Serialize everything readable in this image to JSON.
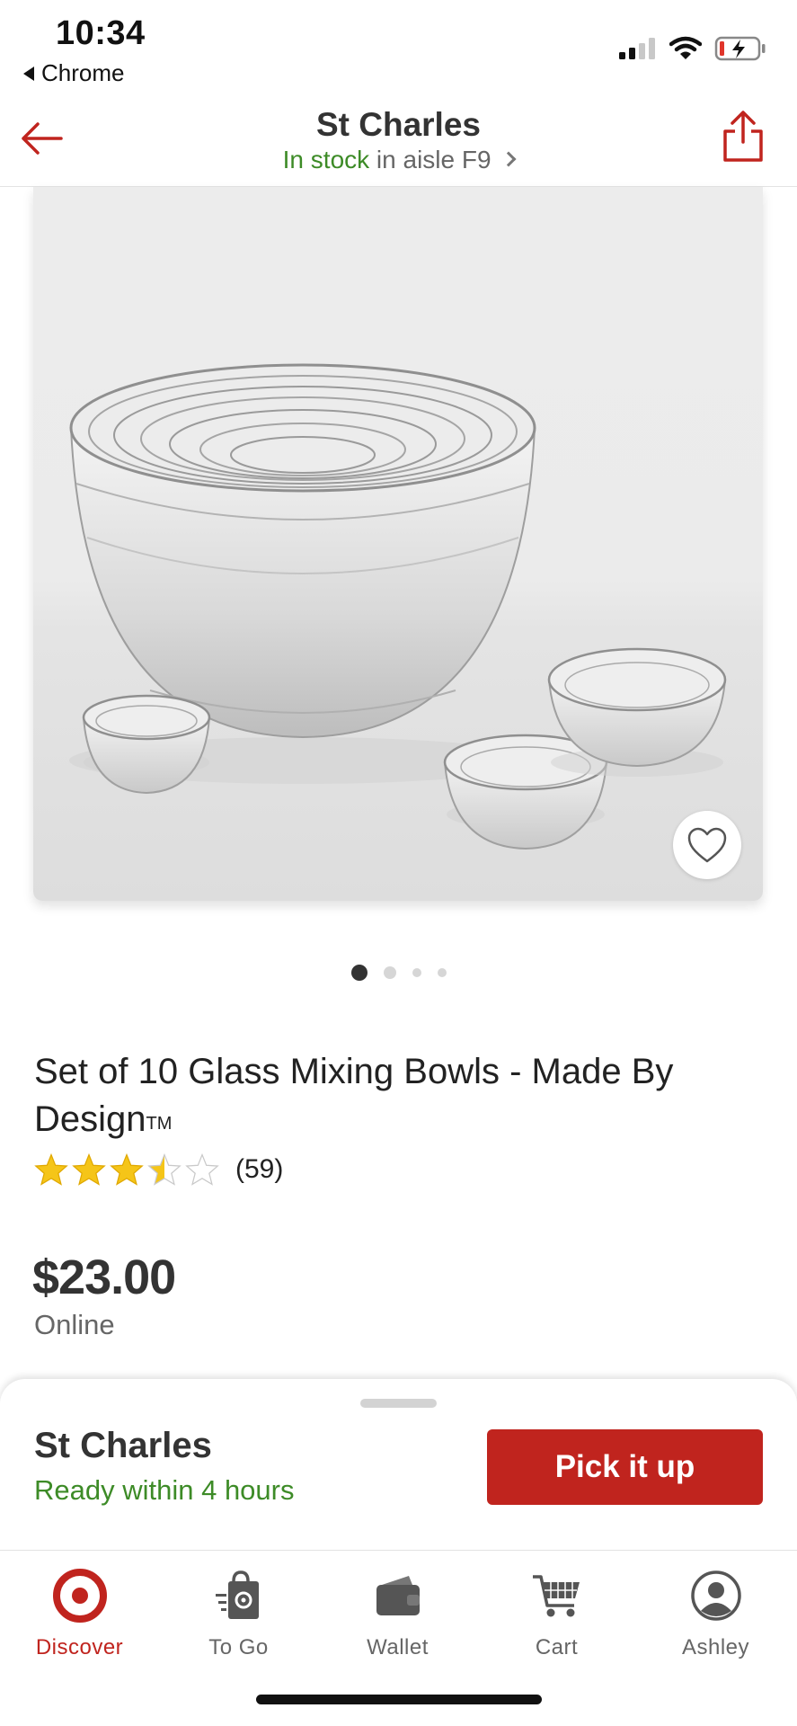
{
  "status_bar": {
    "time": "10:34",
    "back_app": "Chrome"
  },
  "header": {
    "store_name": "St Charles",
    "stock_status": "In stock",
    "aisle_text": "in aisle F9",
    "back_icon": "arrow-left-icon",
    "share_icon": "share-icon"
  },
  "carousel": {
    "total_images": 4,
    "active_index": 0
  },
  "product": {
    "title": "Set of 10 Glass Mixing Bowls - Made By Design",
    "title_mark": "TM",
    "rating": 3.5,
    "rating_max": 5,
    "review_count": "(59)",
    "price": "$23.00",
    "price_note": "Online"
  },
  "pickup_sheet": {
    "store_name": "St Charles",
    "ready_text": "Ready within 4 hours",
    "button_label": "Pick it up"
  },
  "tabs": [
    {
      "label": "Discover",
      "icon": "target-logo-icon",
      "active": true
    },
    {
      "label": "To Go",
      "icon": "shopping-bag-icon",
      "active": false
    },
    {
      "label": "Wallet",
      "icon": "wallet-icon",
      "active": false
    },
    {
      "label": "Cart",
      "icon": "cart-icon",
      "active": false
    },
    {
      "label": "Ashley",
      "icon": "account-icon",
      "active": false
    }
  ],
  "colors": {
    "brand_red": "#c0241e",
    "in_stock_green": "#3d8b27",
    "text_dark": "#333333",
    "star_gold": "#f5c518"
  }
}
